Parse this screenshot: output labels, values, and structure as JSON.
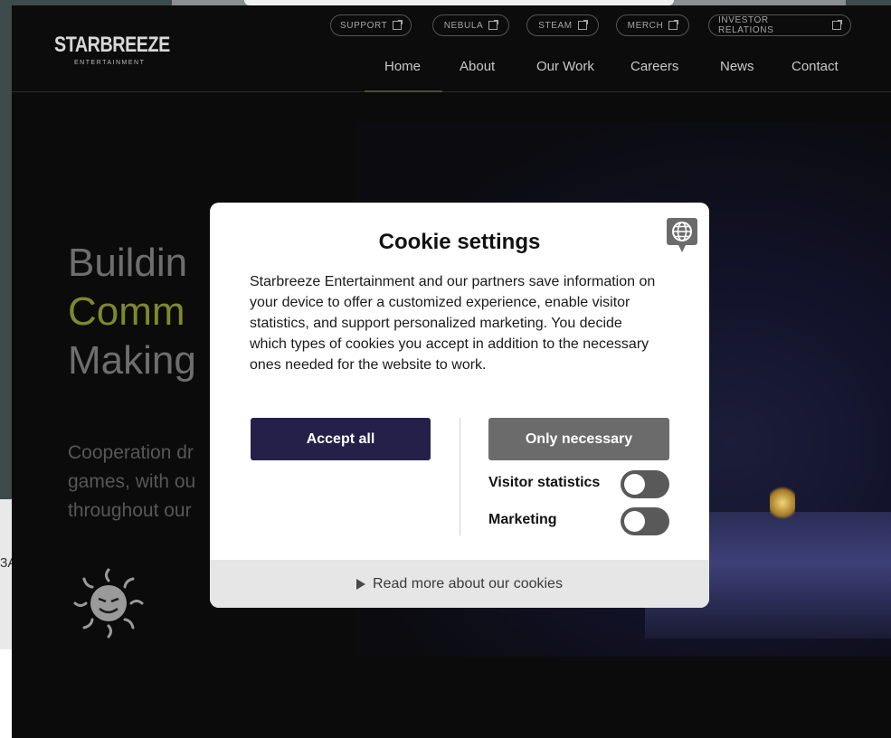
{
  "background": {
    "partial_text": "3A"
  },
  "header": {
    "logo_name": "STARBREEZE",
    "logo_sub": "ENTERTAINMENT",
    "external_links": [
      {
        "label": "SUPPORT"
      },
      {
        "label": "NEBULA"
      },
      {
        "label": "STEAM"
      },
      {
        "label": "MERCH"
      },
      {
        "label": "INVESTOR RELATIONS"
      }
    ],
    "nav": [
      {
        "label": "Home"
      },
      {
        "label": "About"
      },
      {
        "label": "Our Work"
      },
      {
        "label": "Careers"
      },
      {
        "label": "News"
      },
      {
        "label": "Contact"
      }
    ]
  },
  "hero": {
    "title_line1": "Buildin",
    "title_line2": "Comm",
    "title_line3": "Making",
    "subtitle_line1": "Cooperation dr",
    "subtitle_line2": "games, with ou",
    "subtitle_line3": "throughout our",
    "accent_color": "#7d8a2c"
  },
  "cookie_modal": {
    "title": "Cookie settings",
    "body": "Starbreeze Entertainment and our partners save information on your device to offer a customized experience, enable visitor statistics, and support personalized marketing. You decide which types of cookies you accept in addition to the necessary ones needed for the website to work.",
    "accept_all_label": "Accept all",
    "only_necessary_label": "Only necessary",
    "toggles": [
      {
        "label": "Visitor statistics",
        "on": false
      },
      {
        "label": "Marketing",
        "on": false
      }
    ],
    "read_more_label": "Read more about our cookies",
    "globe_icon": "globe-icon",
    "colors": {
      "accept": "#25204a",
      "necessary": "#6b6b6b"
    }
  }
}
